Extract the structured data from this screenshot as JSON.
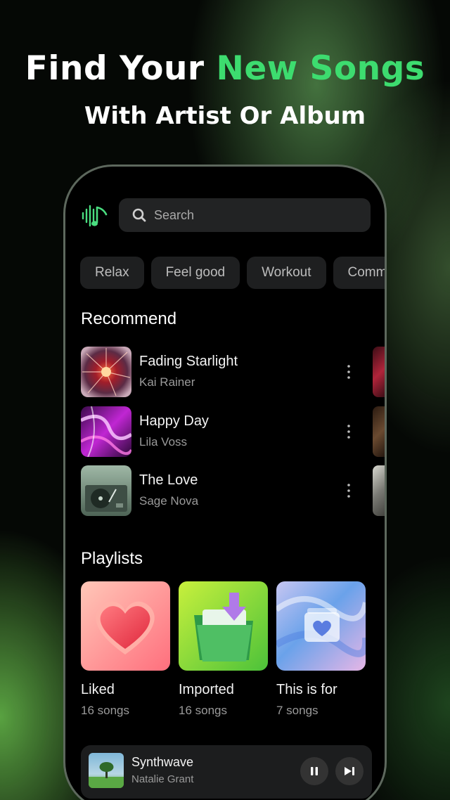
{
  "promo": {
    "headline_part1": "Find Your ",
    "headline_accent": "New Songs",
    "subline": "With Artist Or Album",
    "accent_color": "#3ddc6f"
  },
  "app": {
    "logo_icon": "music-wave-note-icon",
    "search": {
      "placeholder": "Search",
      "icon": "search-icon"
    },
    "chips": [
      "Relax",
      "Feel good",
      "Workout",
      "Comm"
    ],
    "recommend": {
      "title": "Recommend",
      "songs": [
        {
          "title": "Fading Starlight",
          "artist": "Kai Rainer"
        },
        {
          "title": "Happy Day",
          "artist": "Lila Voss"
        },
        {
          "title": "The Love",
          "artist": "Sage Nova"
        }
      ]
    },
    "playlists": {
      "title": "Playlists",
      "items": [
        {
          "name": "Liked",
          "count": "16 songs",
          "icon": "heart-icon"
        },
        {
          "name": "Imported",
          "count": "16 songs",
          "icon": "folder-download-icon"
        },
        {
          "name": "This is for",
          "count": "7 songs",
          "icon": "heart-folder-icon"
        }
      ]
    },
    "now_playing": {
      "title": "Synthwave",
      "artist": "Natalie Grant",
      "pause_icon": "pause-icon",
      "next_icon": "skip-next-icon"
    }
  }
}
